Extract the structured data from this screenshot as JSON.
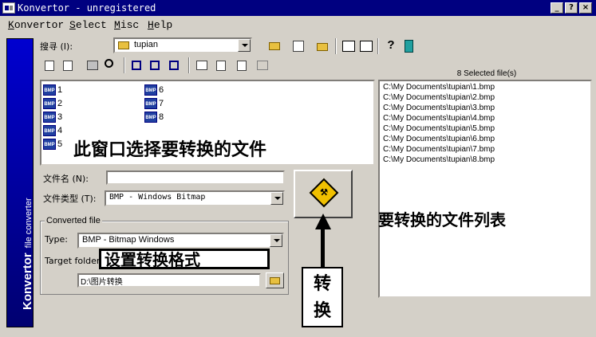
{
  "window": {
    "title": "Konvertor - unregistered",
    "controls": [
      "_",
      "?",
      "×"
    ]
  },
  "menu": [
    {
      "label": "Konvertor",
      "accel": "K",
      "rest": "onvertor"
    },
    {
      "label": "Select",
      "accel": "S",
      "rest": "elect"
    },
    {
      "label": "Misc",
      "accel": "M",
      "rest": "isc"
    },
    {
      "label": "Help",
      "accel": "H",
      "rest": "elp"
    }
  ],
  "sidebar": {
    "brand": "Konvertor",
    "subtitle": "file converter"
  },
  "search": {
    "label": "搜寻 (I):",
    "folder": "tupian"
  },
  "files": [
    "1",
    "2",
    "3",
    "4",
    "5",
    "6",
    "7",
    "8"
  ],
  "annotations": {
    "file_window": "此窗口选择要转换的文件",
    "format": "设置转换格式",
    "convert": [
      "转",
      "换"
    ],
    "list": "要转换的文件列表"
  },
  "filename": {
    "label": "文件名 (N):",
    "value": ""
  },
  "filetype": {
    "label": "文件类型 (T):",
    "value": "BMP - Windows Bitmap"
  },
  "converted": {
    "legend": "Converted file",
    "type_label": "Type:",
    "type_value": "BMP - Bitmap Windows",
    "target_label": "Target folder:",
    "target_value": "D:\\图片转换"
  },
  "selected": {
    "count_text": "8 Selected file(s)",
    "paths": [
      "C:\\My Documents\\tupian\\1.bmp",
      "C:\\My Documents\\tupian\\2.bmp",
      "C:\\My Documents\\tupian\\3.bmp",
      "C:\\My Documents\\tupian\\4.bmp",
      "C:\\My Documents\\tupian\\5.bmp",
      "C:\\My Documents\\tupian\\6.bmp",
      "C:\\My Documents\\tupian\\7.bmp",
      "C:\\My Documents\\tupian\\8.bmp"
    ]
  },
  "file_icon_label": "BMP",
  "colors": {
    "title_bar": "#000080",
    "sidebar": "#0000c0",
    "face": "#d4d0c8"
  }
}
